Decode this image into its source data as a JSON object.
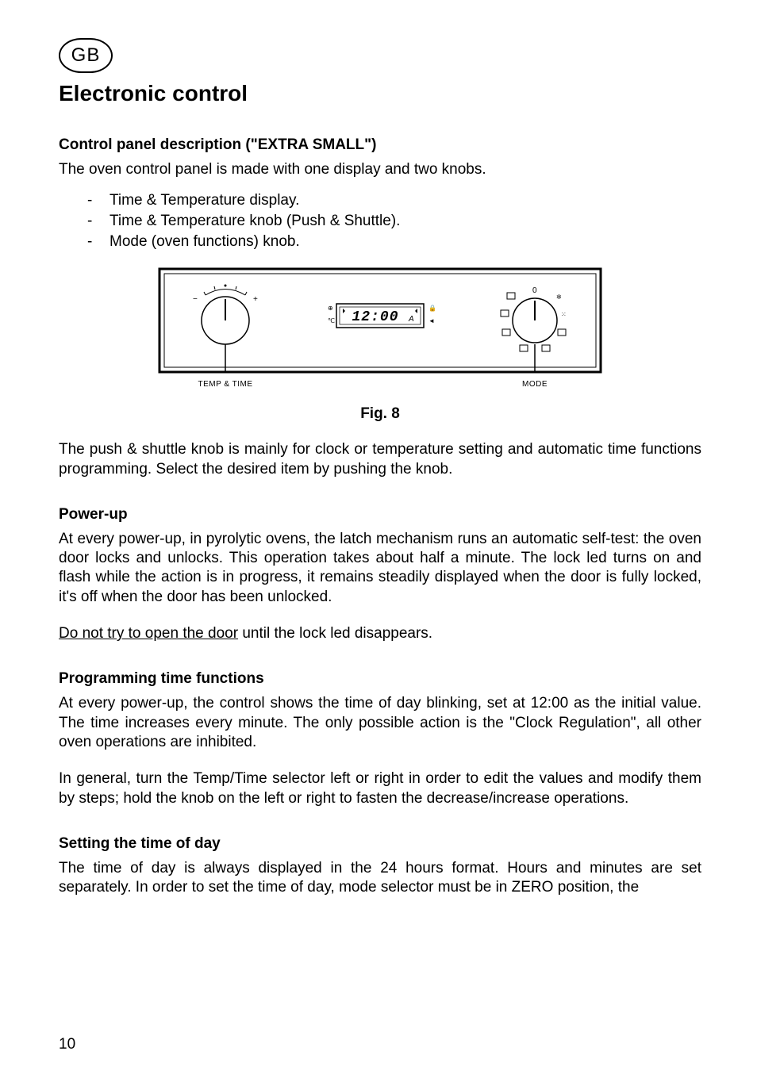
{
  "locale_badge": "GB",
  "page_title": "Electronic control",
  "sections": {
    "control_panel": {
      "heading": "Control panel description (\"EXTRA SMALL\")",
      "intro": "The oven control panel is made with one display and two knobs.",
      "bullets": [
        "Time & Temperature display.",
        "Time & Temperature knob (Push & Shuttle).",
        "Mode (oven functions) knob."
      ],
      "after_figure": "The push & shuttle knob is mainly for clock or temperature setting and automatic time functions programming. Select the desired item by pushing the knob."
    },
    "power_up": {
      "heading": "Power-up",
      "p1": "At every power-up, in pyrolytic ovens, the latch mechanism runs an automatic self-test: the oven door locks and unlocks. This operation  takes about half a minute. The lock led turns on and flash while the action is in progress, it remains steadily displayed when the door is fully locked, it's off when the door has been unlocked.",
      "p2_underlined": "Do not try to open the door",
      "p2_rest": " until the lock led disappears."
    },
    "programming": {
      "heading": "Programming time functions",
      "p1": "At every power-up, the control shows the time of day blinking, set at 12:00 as the initial value. The time increases every minute. The only possible action is the \"Clock Regulation\", all other oven operations are inhibited.",
      "p2": "In general, turn the Temp/Time selector left or right in order to edit the values and modify them by steps; hold the knob on the left or right to fasten the decrease/increase operations."
    },
    "setting_time": {
      "heading": "Setting the time of day",
      "p1": "The time of day is always displayed in the 24 hours format. Hours and minutes are set separately. In order to set the time of day, mode selector must be in ZERO position, the"
    }
  },
  "figure": {
    "left_label": "TEMP & TIME",
    "right_label": "MODE",
    "display_value": "12:00",
    "display_suffix": "A",
    "caption": "Fig. 8",
    "left_knob_minus": "−",
    "left_knob_plus": "+",
    "mode_zero": "0"
  },
  "page_number": "10"
}
